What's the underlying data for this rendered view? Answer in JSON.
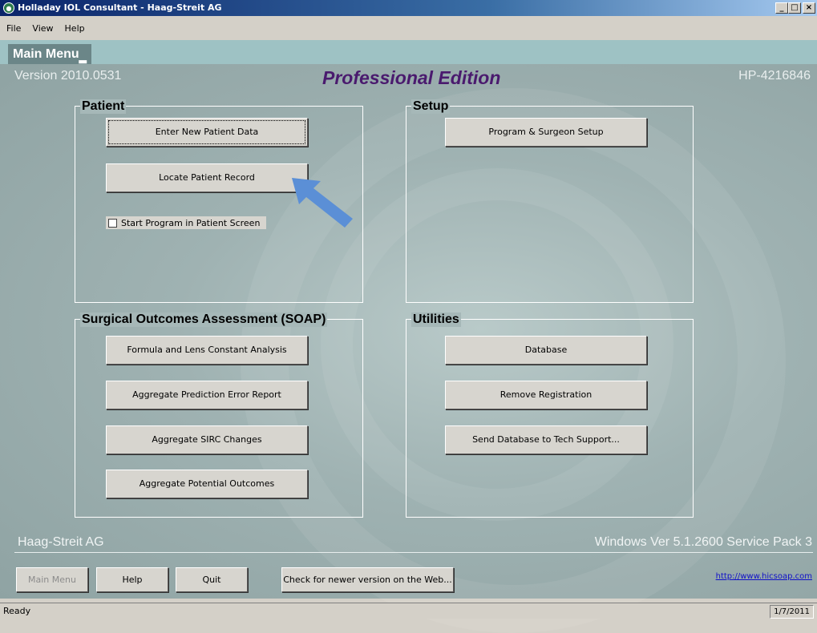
{
  "window": {
    "title": "Holladay IOL Consultant - Haag-Streit AG",
    "app_icon": "app-logo-icon",
    "controls": [
      "_",
      "□",
      "×"
    ]
  },
  "menubar": {
    "items": [
      {
        "label": "File"
      },
      {
        "label": "View"
      },
      {
        "label": "Help"
      }
    ]
  },
  "tab": {
    "label": "Main Menu"
  },
  "header": {
    "version": "Version 2010.0531",
    "edition": "Professional Edition",
    "product_id": "HP-4216846"
  },
  "patient": {
    "title": "Patient",
    "buttons": [
      "Enter New Patient Data",
      "Locate Patient Record"
    ],
    "checkbox_label": "Start Program in Patient Screen",
    "checkbox_checked": false
  },
  "setup": {
    "title": "Setup",
    "buttons": [
      "Program & Surgeon Setup"
    ]
  },
  "soap": {
    "title": "Surgical Outcomes Assessment (SOAP)",
    "buttons": [
      "Formula and Lens Constant Analysis",
      "Aggregate Prediction Error Report",
      "Aggregate SIRC Changes",
      "Aggregate Potential Outcomes"
    ]
  },
  "utilities": {
    "title": "Utilities",
    "buttons": [
      "Database",
      "Remove Registration",
      "Send Database to Tech Support..."
    ]
  },
  "footer": {
    "company": "Haag-Streit AG",
    "os_version": "Windows Ver 5.1.2600 Service Pack 3",
    "buttons": {
      "main_menu": "Main Menu",
      "help": "Help",
      "quit": "Quit",
      "check_version": "Check for newer version on the Web..."
    },
    "link": "http://www.hicsoap.com"
  },
  "status": {
    "text": "Ready",
    "date": "1/7/2011"
  },
  "colors": {
    "tab_bar": "#9ec2c4",
    "edition_text": "#4a1a6e",
    "annotation_arrow": "#5b8fd6"
  }
}
